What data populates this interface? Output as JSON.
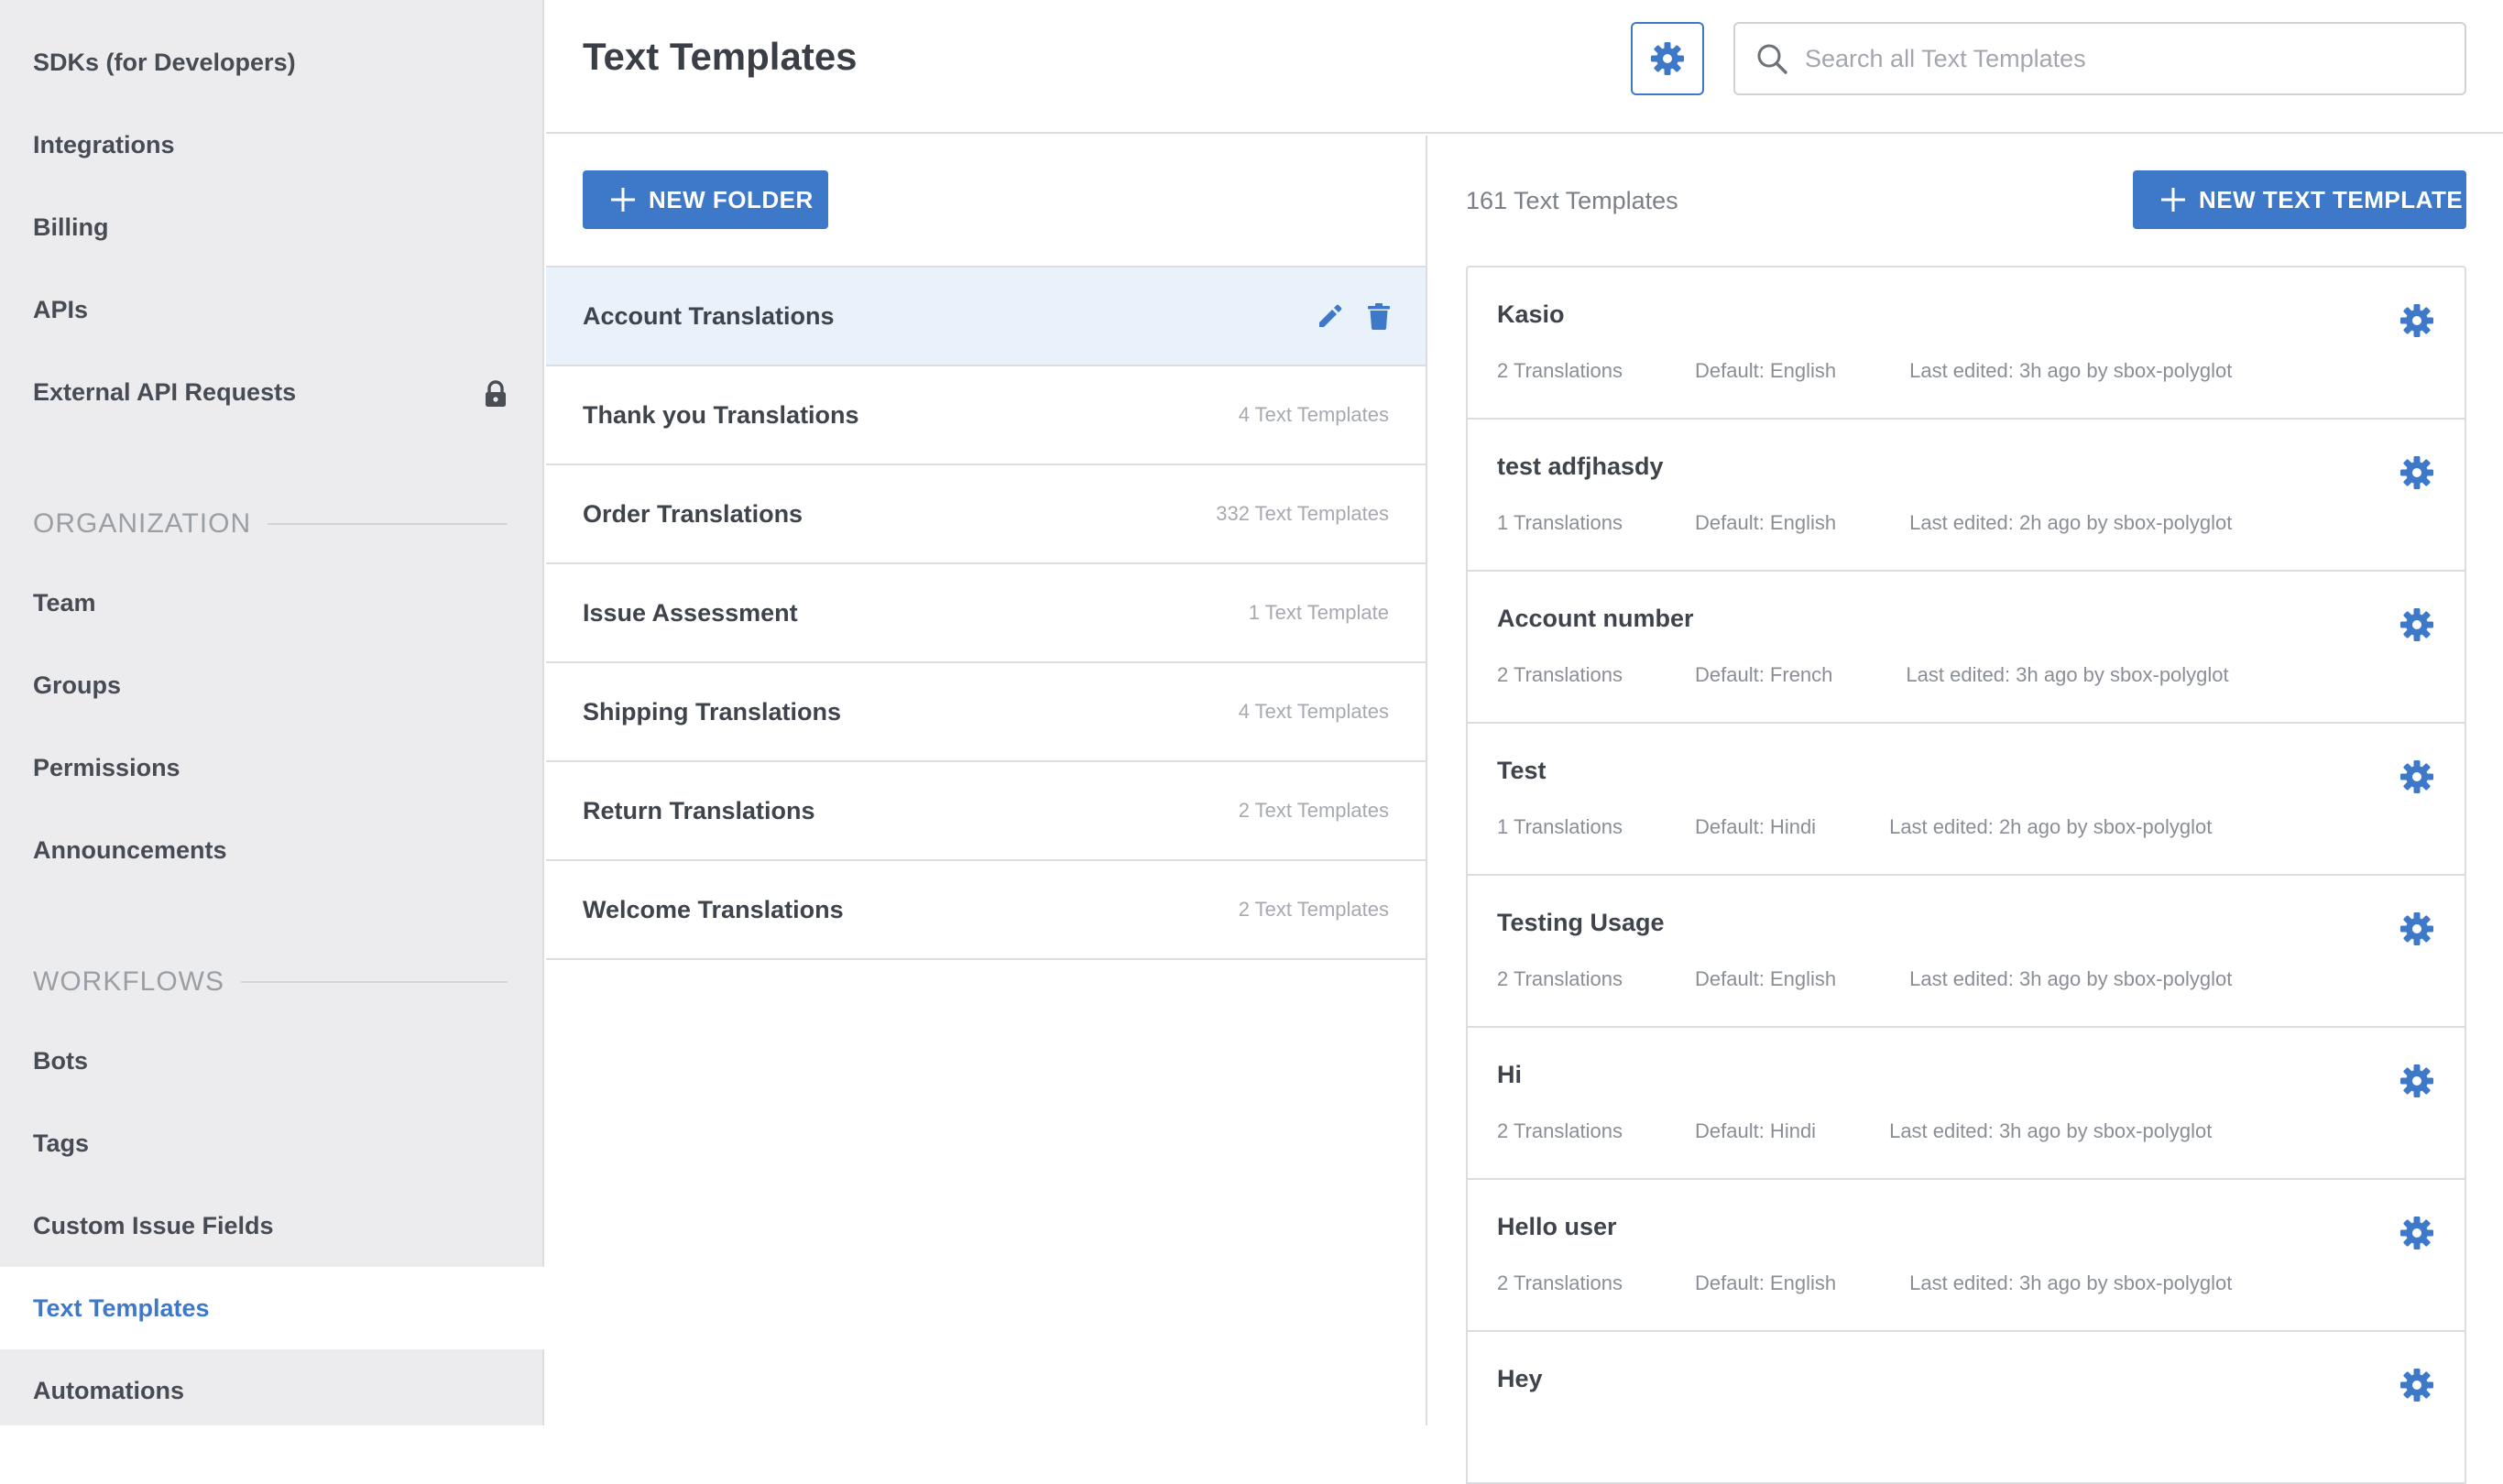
{
  "colors": {
    "accent": "#3d78c9",
    "selected_row": "#e9f1fb",
    "sidebar_bg": "#ececee"
  },
  "sidebar": {
    "items": [
      {
        "label": "SDKs (for Developers)"
      },
      {
        "label": "Integrations"
      },
      {
        "label": "Billing"
      },
      {
        "label": "APIs"
      },
      {
        "label": "External API Requests",
        "icon": "lock-icon"
      }
    ],
    "sections": [
      {
        "title": "ORGANIZATION",
        "items": [
          {
            "label": "Team"
          },
          {
            "label": "Groups"
          },
          {
            "label": "Permissions"
          },
          {
            "label": "Announcements"
          }
        ]
      },
      {
        "title": "WORKFLOWS",
        "items": [
          {
            "label": "Bots"
          },
          {
            "label": "Tags"
          },
          {
            "label": "Custom Issue Fields"
          },
          {
            "label": "Text Templates",
            "active": true
          },
          {
            "label": "Automations"
          }
        ]
      }
    ]
  },
  "header": {
    "title": "Text Templates",
    "settings_icon": "gear-icon",
    "search": {
      "placeholder": "Search all Text Templates",
      "value": ""
    }
  },
  "folders": {
    "new_folder_label": "NEW FOLDER",
    "items": [
      {
        "name": "Account Translations",
        "count": "",
        "selected": true
      },
      {
        "name": "Thank you Translations",
        "count": "4 Text Templates"
      },
      {
        "name": "Order Translations",
        "count": "332 Text Templates"
      },
      {
        "name": "Issue Assessment",
        "count": "1 Text Template"
      },
      {
        "name": "Shipping Translations",
        "count": "4 Text Templates"
      },
      {
        "name": "Return Translations",
        "count": "2 Text Templates"
      },
      {
        "name": "Welcome Translations",
        "count": "2 Text Templates"
      }
    ]
  },
  "templates": {
    "count_label": "161 Text Templates",
    "new_template_label": "NEW TEXT TEMPLATE",
    "items": [
      {
        "name": "Kasio",
        "translations": "2 Translations",
        "default": "Default: English",
        "edited": "Last edited: 3h ago by sbox-polyglot"
      },
      {
        "name": "test adfjhasdy",
        "translations": "1 Translations",
        "default": "Default: English",
        "edited": "Last edited: 2h ago by sbox-polyglot"
      },
      {
        "name": "Account number",
        "translations": "2 Translations",
        "default": "Default: French",
        "edited": "Last edited: 3h ago by sbox-polyglot"
      },
      {
        "name": "Test",
        "translations": "1 Translations",
        "default": "Default: Hindi",
        "edited": "Last edited: 2h ago by sbox-polyglot"
      },
      {
        "name": "Testing Usage",
        "translations": "2 Translations",
        "default": "Default: English",
        "edited": "Last edited: 3h ago by sbox-polyglot"
      },
      {
        "name": "Hi",
        "translations": "2 Translations",
        "default": "Default: Hindi",
        "edited": "Last edited: 3h ago by sbox-polyglot"
      },
      {
        "name": "Hello user",
        "translations": "2 Translations",
        "default": "Default: English",
        "edited": "Last edited: 3h ago by sbox-polyglot"
      },
      {
        "name": "Hey",
        "translations": "",
        "default": "",
        "edited": ""
      }
    ]
  }
}
